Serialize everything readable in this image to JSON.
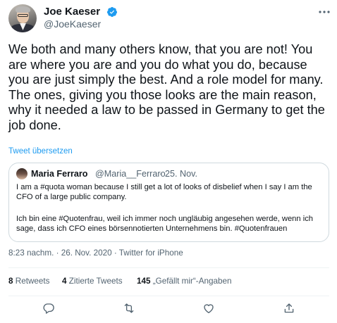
{
  "author": {
    "name": "Joe Kaeser",
    "handle": "@JoeKaeser"
  },
  "tweet": {
    "text": "We both and many others know, that you are not! You are where you are and you do what you do, because you are just simply the best. And a role model for many. The ones, giving you those looks are the main reason, why it needed a law to be passed in Germany to get the job done.",
    "translate_label": "Tweet übersetzen",
    "timestamp": "8:23 nachm. · 26. Nov. 2020 · Twitter for iPhone"
  },
  "quoted": {
    "name": "Maria Ferraro",
    "handle": "@Maria__Ferraro",
    "separator": "·",
    "date": "25. Nov.",
    "text_en": "I am a #quota woman because I still get a lot of looks of disbelief when I say I am the CFO of a large public company.",
    "text_de": "Ich bin eine #Quotenfrau, weil ich immer noch ungläubig angesehen werde, wenn ich sage, dass ich CFO eines börsennotierten Unternehmens bin. #Quotenfrauen"
  },
  "stats": {
    "retweets_count": "8",
    "retweets_label": " Retweets",
    "quotes_count": "4",
    "quotes_label": " Zitierte Tweets",
    "likes_count": "145",
    "likes_label": " „Gefällt mir“-Angaben"
  },
  "colors": {
    "accent": "#1d9bf0",
    "secondary_text": "#536471",
    "border": "#cfd9de"
  },
  "icons": {
    "verified": "verified-badge-icon",
    "more": "more-options-icon",
    "reply": "reply-icon",
    "retweet": "retweet-icon",
    "like": "like-icon",
    "share": "share-icon"
  }
}
